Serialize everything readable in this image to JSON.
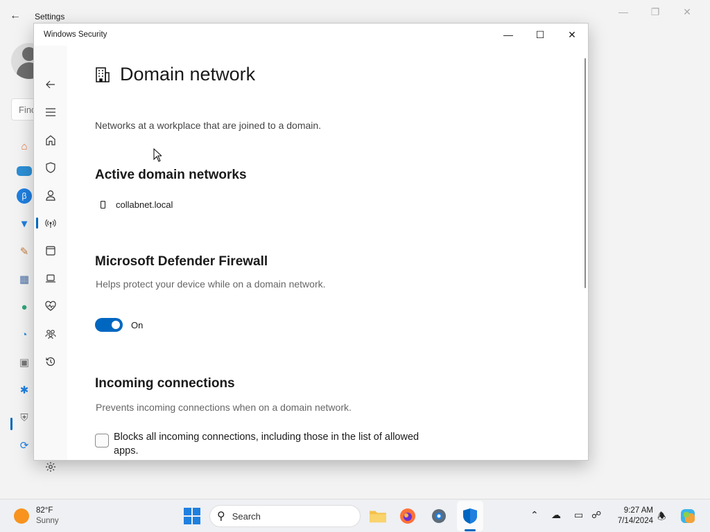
{
  "settings_bg": {
    "title": "Settings",
    "search_placeholder": "Find"
  },
  "window": {
    "title": "Windows Security"
  },
  "page": {
    "title": "Domain network",
    "subtitle": "Networks at a workplace that are joined to a domain."
  },
  "active_networks": {
    "heading": "Active domain networks",
    "items": [
      "collabnet.local"
    ]
  },
  "firewall": {
    "heading": "Microsoft Defender Firewall",
    "description": "Helps protect your device while on a domain network.",
    "toggle_state": "On"
  },
  "incoming": {
    "heading": "Incoming connections",
    "description": "Prevents incoming connections when on a domain network.",
    "checkbox_label": "Blocks all incoming connections, including those in the list of allowed apps.",
    "checked": false
  },
  "nav": {
    "items": [
      "back",
      "menu",
      "home",
      "virus-threat-protection",
      "account-protection",
      "firewall-network-protection",
      "app-browser-control",
      "device-security",
      "device-performance-health",
      "family-options",
      "protection-history",
      "settings"
    ],
    "selected": "firewall-network-protection"
  },
  "taskbar": {
    "weather_temp": "82°F",
    "weather_condition": "Sunny",
    "search_label": "Search",
    "time": "9:27 AM",
    "date": "7/14/2024"
  },
  "colors": {
    "accent": "#0067c0"
  }
}
